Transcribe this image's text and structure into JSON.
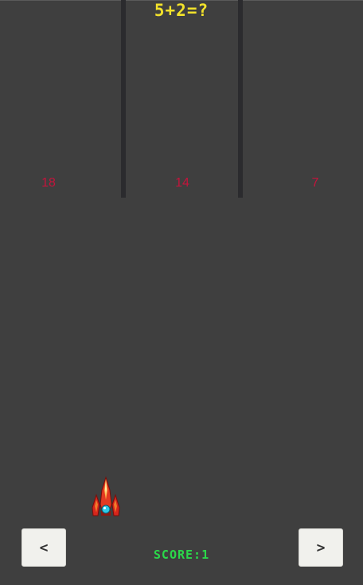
{
  "game": {
    "question": "5+2=?",
    "answers": [
      "18",
      "14",
      "7"
    ],
    "score_label": "SCORE:",
    "score_value": "1",
    "score_text": "SCORE:1"
  },
  "controls": {
    "left_label": "<",
    "right_label": ">"
  },
  "colors": {
    "background": "#3f3f3f",
    "question": "#f2e22b",
    "answer": "#c4143c",
    "score": "#2bd84a",
    "button": "#f1f1ed"
  },
  "icons": {
    "player": "spaceship-icon"
  }
}
